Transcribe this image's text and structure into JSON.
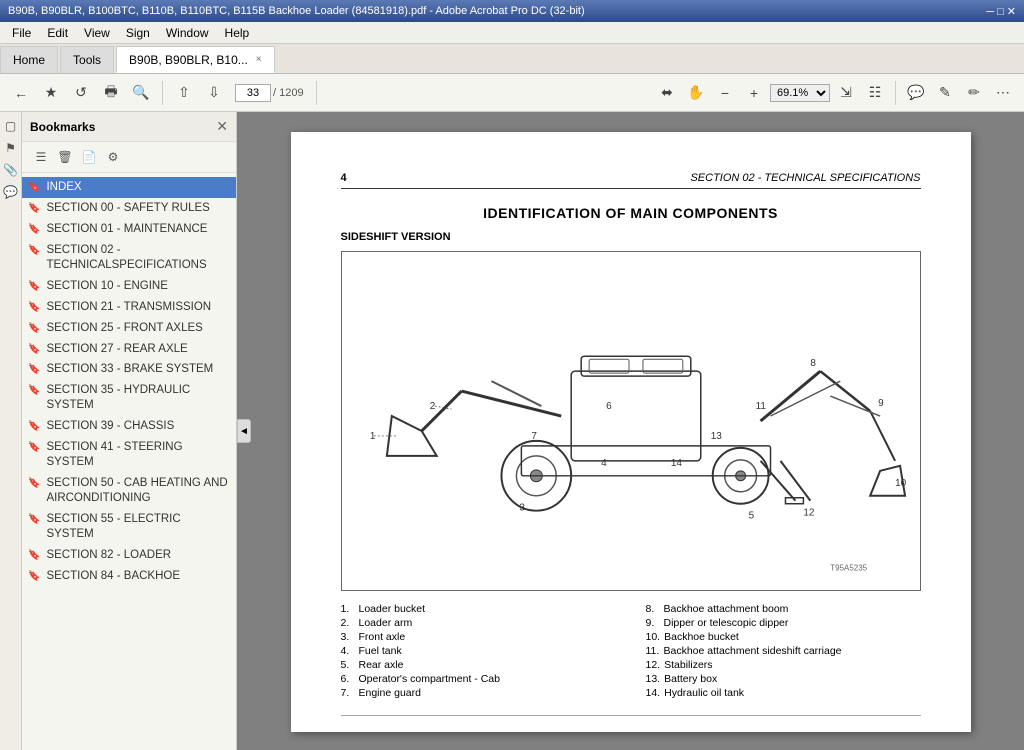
{
  "titlebar": {
    "text": "B90B, B90BLR, B100BTC, B110B, B110BTC, B115B Backhoe Loader (84581918).pdf - Adobe Acrobat Pro DC (32-bit)"
  },
  "menubar": {
    "items": [
      "File",
      "Edit",
      "View",
      "Sign",
      "Window",
      "Help"
    ]
  },
  "tabs": {
    "home": "Home",
    "tools": "Tools",
    "document": "B90B, B90BLR, B10...",
    "close": "×"
  },
  "toolbar": {
    "page_current": "33",
    "page_total": "1209",
    "zoom": "69.1%"
  },
  "sidebar": {
    "title": "Bookmarks",
    "items": [
      {
        "label": "INDEX",
        "active": true
      },
      {
        "label": "SECTION 00 - SAFETY RULES",
        "active": false
      },
      {
        "label": "SECTION 01 - MAINTENANCE",
        "active": false
      },
      {
        "label": "SECTION 02 - TECHNICALSPECIFICATIONS",
        "active": false
      },
      {
        "label": "SECTION 10 - ENGINE",
        "active": false
      },
      {
        "label": "SECTION 21 - TRANSMISSION",
        "active": false
      },
      {
        "label": "SECTION 25 - FRONT AXLES",
        "active": false
      },
      {
        "label": "SECTION 27 - REAR AXLE",
        "active": false
      },
      {
        "label": "SECTION 33 - BRAKE SYSTEM",
        "active": false
      },
      {
        "label": "SECTION 35 - HYDRAULIC SYSTEM",
        "active": false
      },
      {
        "label": "SECTION 39 - CHASSIS",
        "active": false
      },
      {
        "label": "SECTION 41 - STEERING SYSTEM",
        "active": false
      },
      {
        "label": "SECTION 50 - CAB HEATING AND AIRCONDITIONING",
        "active": false
      },
      {
        "label": "SECTION 55 - ELECTRIC SYSTEM",
        "active": false
      },
      {
        "label": "SECTION 82 - LOADER",
        "active": false
      },
      {
        "label": "SECTION 84 - BACKHOE",
        "active": false
      }
    ]
  },
  "document": {
    "page_num": "4",
    "section_title": "SECTION 02 - TECHNICAL SPECIFICATIONS",
    "main_title": "IDENTIFICATION OF MAIN COMPONENTS",
    "subtitle": "SIDESHIFT VERSION",
    "parts": [
      {
        "num": "1.",
        "label": "Loader bucket"
      },
      {
        "num": "8.",
        "label": "Backhoe attachment boom"
      },
      {
        "num": "2.",
        "label": "Loader arm"
      },
      {
        "num": "9.",
        "label": "Dipper or telescopic dipper"
      },
      {
        "num": "3.",
        "label": "Front axle"
      },
      {
        "num": "10.",
        "label": "Backhoe bucket"
      },
      {
        "num": "4.",
        "label": "Fuel tank"
      },
      {
        "num": "11.",
        "label": "Backhoe attachment sideshift carriage"
      },
      {
        "num": "5.",
        "label": "Rear axle"
      },
      {
        "num": "12.",
        "label": "Stabilizers"
      },
      {
        "num": "6.",
        "label": "Operator's compartment - Cab"
      },
      {
        "num": "13.",
        "label": "Battery box"
      },
      {
        "num": "7.",
        "label": "Engine guard"
      },
      {
        "num": "14.",
        "label": "Hydraulic oil tank"
      }
    ]
  }
}
